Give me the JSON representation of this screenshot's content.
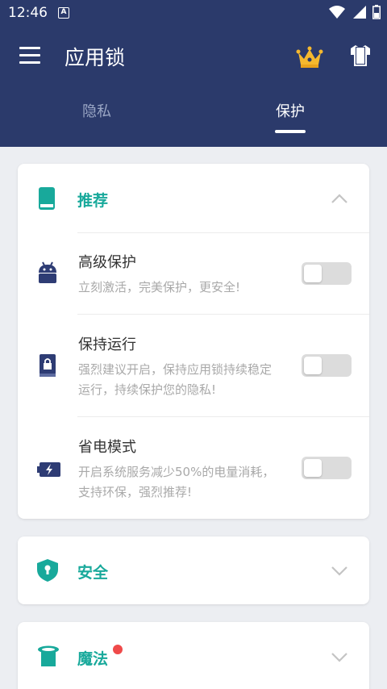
{
  "status_bar": {
    "time": "12:46",
    "notification_glyph": "A"
  },
  "app_bar": {
    "title": "应用锁"
  },
  "tabs": [
    {
      "label": "隐私",
      "selected": false
    },
    {
      "label": "保护",
      "selected": true
    }
  ],
  "sections": {
    "recommended": {
      "title": "推荐",
      "expanded": true,
      "icon": "phone-icon",
      "items": [
        {
          "title": "高级保护",
          "desc": "立刻激活，完美保护，更安全!",
          "enabled": false,
          "icon": "android-icon"
        },
        {
          "title": "保持运行",
          "desc": "强烈建议开启，保持应用锁持续稳定运行，持续保护您的隐私!",
          "enabled": false,
          "icon": "lock-book-icon"
        },
        {
          "title": "省电模式",
          "desc": "开启系统服务减少50%的电量消耗，支持环保，强烈推荐!",
          "enabled": false,
          "icon": "battery-icon"
        }
      ]
    },
    "security": {
      "title": "安全",
      "expanded": false,
      "icon": "shield-lock-icon"
    },
    "magic": {
      "title": "魔法",
      "expanded": false,
      "icon": "magic-hat-icon",
      "has_badge": true
    }
  },
  "colors": {
    "header_bg": "#2b3a6b",
    "accent_teal": "#18a99b",
    "icon_navy": "#2e3c74",
    "badge_red": "#ef4a4a",
    "crown_gold": "#f5b82e"
  }
}
